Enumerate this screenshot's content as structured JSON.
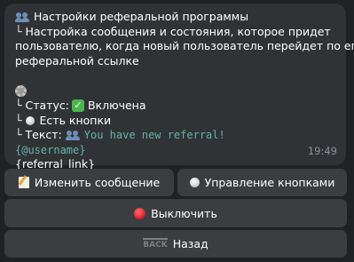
{
  "message": {
    "title": "Настройки реферальной программы",
    "description_line1": "Настройка сообщения и состояния, которое придет",
    "description_line2": "пользователю, когда новый пользователь перейдет по его",
    "description_line3": "реферальной ссылке",
    "status_label": "Статус:",
    "status_value": "Включена",
    "buttons_label": "Есть кнопки",
    "text_label": "Текст:",
    "text_preview": "You have new referral!",
    "placeholder_username": "{@username}",
    "placeholder_link": "{referral_link}",
    "tree_branch": "└",
    "time": "19:49"
  },
  "keyboard": {
    "edit_message": "Изменить сообщение",
    "manage_buttons": "Управление кнопками",
    "disable": "Выключить",
    "back": "Назад",
    "back_icon_text": "BACK"
  },
  "icons": {
    "title": "people-icon",
    "settings": "gear-icon",
    "status": "check-icon",
    "buttons": "white-circle-icon",
    "text": "people-icon",
    "edit": "memo-icon",
    "manage": "white-circle-icon",
    "disable": "red-circle-icon",
    "back": "back-arrow-icon"
  },
  "colors": {
    "background": "#1f2225",
    "bubble": "#303336",
    "button": "#3a3e41",
    "code_text": "#63b3a8",
    "timestamp": "#8d949a"
  }
}
